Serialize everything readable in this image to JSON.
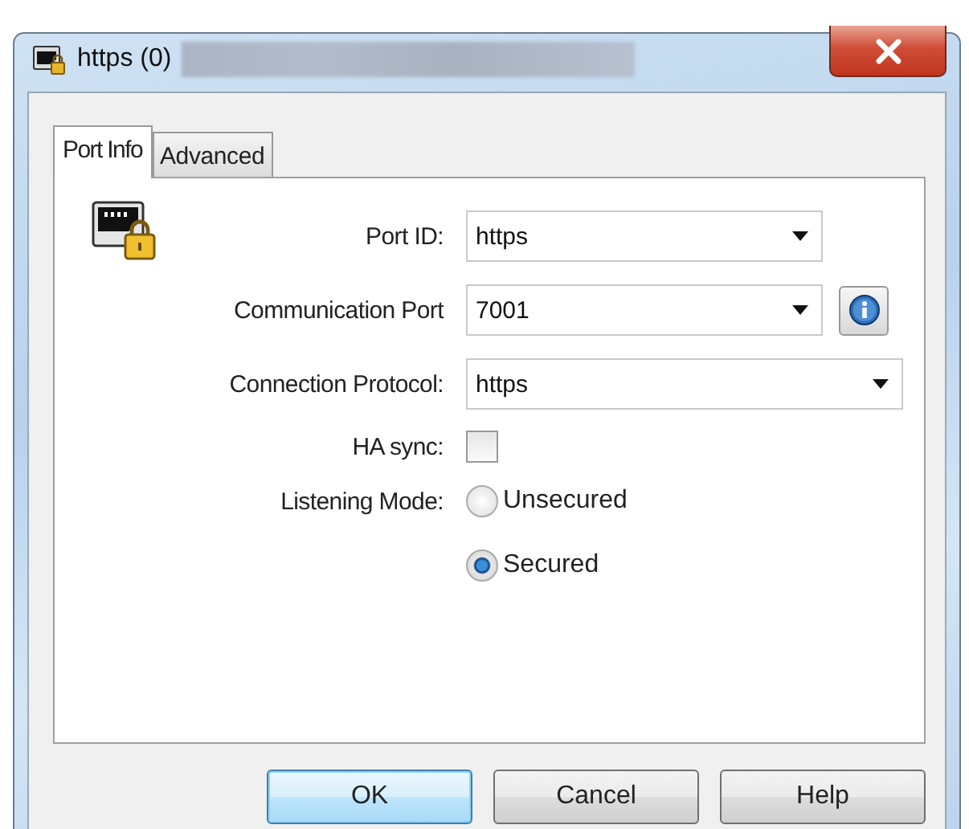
{
  "window": {
    "title": "https (0)"
  },
  "tabs": [
    {
      "label": "Port Info",
      "selected": true
    },
    {
      "label": "Advanced",
      "selected": false
    }
  ],
  "fields": [
    {
      "kind": "dropdown",
      "label": "Port ID:",
      "value": "https",
      "info_button": false
    },
    {
      "kind": "dropdown",
      "label": "Communication Port",
      "value": "7001",
      "info_button": true
    },
    {
      "kind": "dropdown",
      "label": "Connection Protocol:",
      "value": "https",
      "info_button": false
    },
    {
      "kind": "checkbox",
      "label": "HA sync:",
      "checked": false
    },
    {
      "kind": "radio_group",
      "label": "Listening Mode:",
      "options": [
        {
          "label": "Unsecured",
          "selected": false
        },
        {
          "label": "Secured",
          "selected": true
        }
      ]
    }
  ],
  "buttons": [
    {
      "label": "OK",
      "default": true
    },
    {
      "label": "Cancel",
      "default": false
    },
    {
      "label": "Help",
      "default": false
    }
  ]
}
